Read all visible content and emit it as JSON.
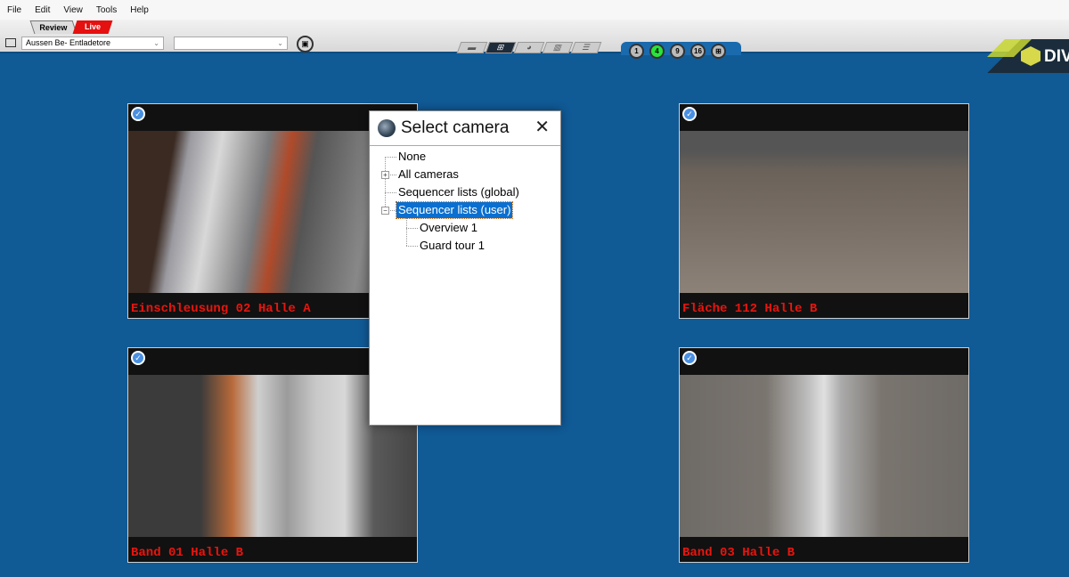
{
  "menu": [
    "File",
    "Edit",
    "View",
    "Tools",
    "Help"
  ],
  "mode_tabs": {
    "review": "Review",
    "live": "Live"
  },
  "toolbar": {
    "camera_group": "Aussen Be- Entladetore",
    "second_select": "",
    "save_icon": "floppy-disk-icon"
  },
  "view_tabs": [
    "single-view-icon",
    "grid-view-icon",
    "3d-view-icon",
    "map-view-icon",
    "list-view-icon"
  ],
  "layout_buttons": [
    "1",
    "4",
    "9",
    "16",
    "custom-layout-icon"
  ],
  "active_layout": "4",
  "logo_text": "DIV",
  "cameras": [
    {
      "label": "Einschleusung 02 Halle A"
    },
    {
      "label": "Fläche 112 Halle B"
    },
    {
      "label": "Band 01 Halle B"
    },
    {
      "label": "Band 03 Halle B"
    }
  ],
  "dialog": {
    "title": "Select camera",
    "tree": [
      "None",
      "All cameras",
      "Sequencer lists (global)",
      "Sequencer lists (user)",
      "Overview 1",
      "Guard tour 1"
    ],
    "selected": "Sequencer lists (user)"
  },
  "colors": {
    "background": "#105a96",
    "live": "#e51010",
    "label": "#e8150e",
    "selection": "#0a6fd0",
    "active_layout": "#29e33b"
  }
}
